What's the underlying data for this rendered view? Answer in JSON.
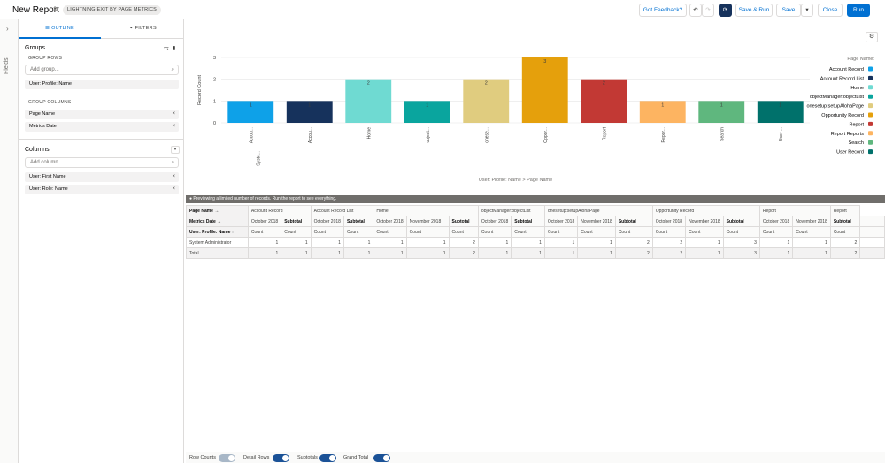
{
  "header": {
    "title": "New Report",
    "badge": "LIGHTNING EXIT BY PAGE METRICS",
    "buttons": {
      "feedback": "Got Feedback?",
      "undo": "↶",
      "redo": "↷",
      "save_run": "Save & Run",
      "save": "Save",
      "save_menu": "▾",
      "close": "Close",
      "run": "Run"
    },
    "edit_icon": "pencil-icon",
    "refresh_icon": "refresh-icon"
  },
  "rail": {
    "label": "Fields",
    "chevron": "›"
  },
  "outline": {
    "tabs": [
      "OUTLINE",
      "FILTERS"
    ],
    "tab_icons": [
      "☰",
      "⏷"
    ],
    "groups": {
      "title": "Groups",
      "rows_title": "GROUP ROWS",
      "rows_placeholder": "Add group...",
      "rows": [
        "User: Profile: Name"
      ],
      "cols_title": "GROUP COLUMNS",
      "cols": [
        "Page Name",
        "Metrics Date"
      ]
    },
    "columns": {
      "title": "Columns",
      "placeholder": "Add column...",
      "items": [
        "User: First Name",
        "User: Role: Name"
      ]
    },
    "remove_glyph": "×",
    "search_glyph": "⌕",
    "swap_glyph": "⇆",
    "trash_glyph": "🗑",
    "dropdown_glyph": "▾"
  },
  "chart_data": {
    "type": "bar",
    "categories": [
      "System Administrator"
    ],
    "tick_labels": [
      "Accou...",
      "Accou...",
      "Home",
      "object...",
      "onese...",
      "Oppor...",
      "Report",
      "Repor...",
      "Search",
      "User ..."
    ],
    "tick_sublabel": "Syste...",
    "series": [
      {
        "name": "Account Record",
        "values": [
          1
        ],
        "color": "#0ea1e8"
      },
      {
        "name": "Account Record List",
        "values": [
          1
        ],
        "color": "#16325c"
      },
      {
        "name": "Home",
        "values": [
          2
        ],
        "color": "#6fdad2"
      },
      {
        "name": "objectManager:objectList",
        "values": [
          1
        ],
        "color": "#0aa59e"
      },
      {
        "name": "onesetup:setupAlohaPage",
        "values": [
          2
        ],
        "color": "#e0cc7f"
      },
      {
        "name": "Opportunity Record",
        "values": [
          3
        ],
        "color": "#e5a00c"
      },
      {
        "name": "Report",
        "values": [
          2
        ],
        "color": "#c23934"
      },
      {
        "name": "Report Reports",
        "values": [
          1
        ],
        "color": "#fdb461"
      },
      {
        "name": "Search",
        "values": [
          1
        ],
        "color": "#5fb77e"
      },
      {
        "name": "User Record",
        "values": [
          1
        ],
        "color": "#00716b"
      }
    ],
    "ylabel": "Record Count",
    "xlabel": "User: Profile: Name > Page Name",
    "legend_title": "Page Name",
    "yticks": [
      0,
      1,
      2,
      3
    ],
    "ylim": [
      0,
      3
    ],
    "legend_position": "right",
    "grid": true
  },
  "gear_icon": "⚙",
  "table": {
    "banner": "Previewing a limited number of records. Run the report to see everything.",
    "banner_icon": "info-icon",
    "row_labels": [
      "Page Name",
      "Metrics Date",
      "User: Profile: Name"
    ],
    "label_glyphs": [
      "→",
      "→",
      "↑"
    ],
    "pages": [
      "Account Record",
      "Account Record List",
      "Home",
      "objectManager:objectList",
      "onesetup:setupAlohaPage",
      "Opportunity Record",
      "Report",
      "Report"
    ],
    "dates": [
      "October 2018",
      "Subtotal",
      "October 2018",
      "Subtotal",
      "October 2018",
      "November 2018",
      "Subtotal",
      "October 2018",
      "Subtotal",
      "October 2018",
      "November 2018",
      "Subtotal",
      "October 2018",
      "November 2018",
      "Subtotal",
      "October 2018",
      "November 2018",
      "Subtotal",
      ""
    ],
    "count_label": "Count",
    "rows": [
      {
        "label": "System Administrator",
        "values": [
          "1",
          "1",
          "1",
          "1",
          "1",
          "1",
          "2",
          "1",
          "1",
          "1",
          "1",
          "2",
          "2",
          "1",
          "3",
          "1",
          "1",
          "2",
          ""
        ]
      },
      {
        "label": "Total",
        "values": [
          "1",
          "1",
          "1",
          "1",
          "1",
          "1",
          "2",
          "1",
          "1",
          "1",
          "1",
          "2",
          "2",
          "1",
          "3",
          "1",
          "1",
          "2",
          ""
        ]
      }
    ]
  },
  "footer": {
    "row_counts": "Row Counts",
    "detail_rows": "Detail Rows",
    "subtotals": "Subtotals",
    "grand_total": "Grand Total",
    "row_counts_on": false,
    "detail_rows_on": true,
    "subtotals_on": true,
    "grand_total_on": true
  }
}
